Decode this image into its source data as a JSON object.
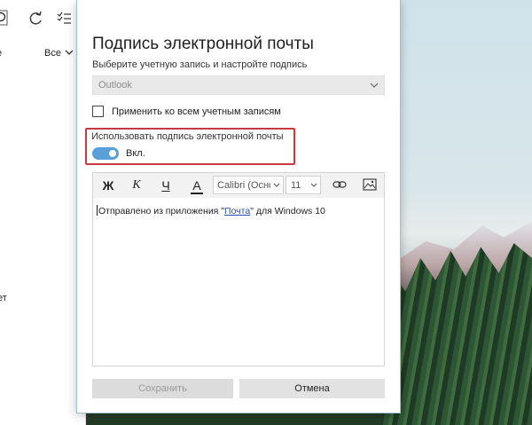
{
  "background_app": {
    "toolbar_icons": [
      "search-icon",
      "sync-icon",
      "select-mode-icon"
    ],
    "filter": {
      "left_char": "е",
      "label": "Все"
    },
    "clipped_text": "ет"
  },
  "dialog": {
    "title": "Подпись электронной почты",
    "subtitle": "Выберите учетную запись и настройте подпись",
    "account": {
      "value": "Outlook"
    },
    "apply_all": {
      "label": "Применить ко всем учетным записям",
      "checked": false
    },
    "use_signature": {
      "label": "Использовать подпись электронной почты",
      "state_label": "Вкл.",
      "enabled": true
    },
    "toolbar": {
      "bold": "Ж",
      "italic": "К",
      "underline": "Ч",
      "font_color": "A",
      "font": "Calibri (Осно",
      "size": "11",
      "icons": [
        "link-icon",
        "image-icon"
      ]
    },
    "signature": {
      "prefix": "Отправлено из приложения \"",
      "link": "Почта",
      "suffix": "\" для Windows 10"
    },
    "buttons": {
      "save": "Сохранить",
      "cancel": "Отмена"
    }
  },
  "colors": {
    "highlight": "#c83a3e",
    "toggle_on": "#5a9fd8",
    "link": "#2b4fa8",
    "dialog_border": "#9dc3d2"
  }
}
